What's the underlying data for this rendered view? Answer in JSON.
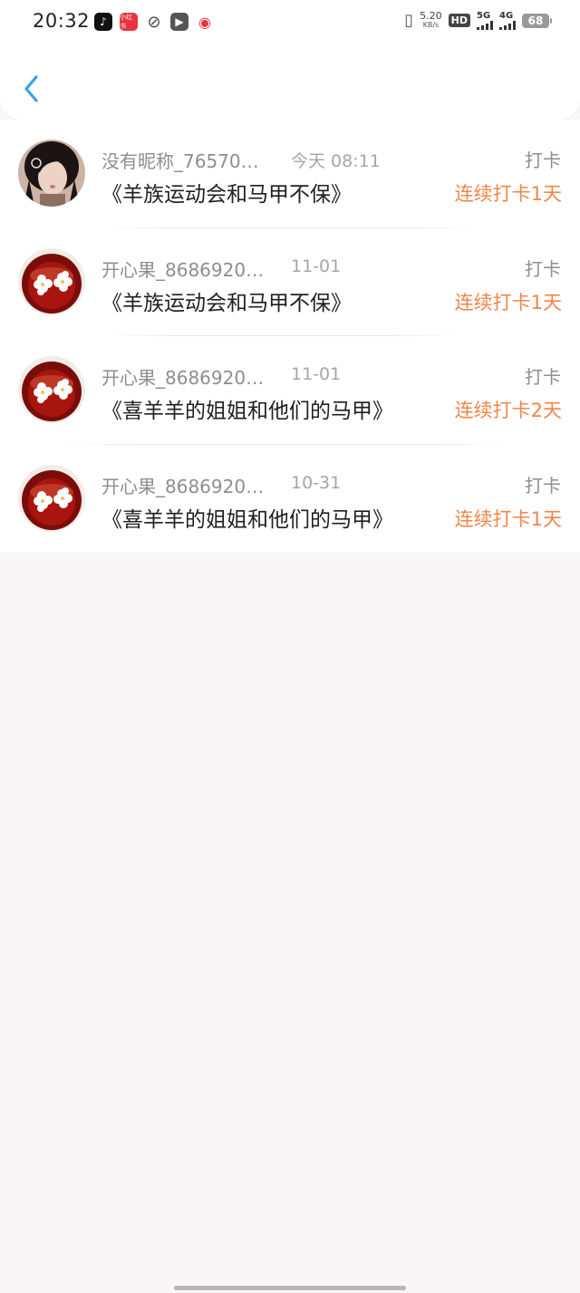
{
  "status_bar": {
    "time": "20:32",
    "app_icons": [
      "tiktok-icon",
      "xiaohongshu-icon",
      "loop-icon",
      "video-play-icon",
      "red-app-icon"
    ],
    "app_labels": {
      "xiaohongshu": "小红书"
    },
    "net_speed_value": "5.20",
    "net_speed_unit": "KB/s",
    "hd_label": "HD",
    "sim1_label": "5G",
    "sim2_label": "4G",
    "battery": "68"
  },
  "header": {
    "back_icon": "chevron-left-icon",
    "accent": "#3aa0e8"
  },
  "entries": [
    {
      "name": "没有昵称_76570…",
      "date": "今天 08:11",
      "book": "《羊族运动会和马甲不保》",
      "tag": "打卡",
      "streak": "连续打卡1天",
      "avatar": "girl-avatar"
    },
    {
      "name": "开心果_8686920…",
      "date": "11-01",
      "book": "《羊族运动会和马甲不保》",
      "tag": "打卡",
      "streak": "连续打卡1天",
      "avatar": "flower-avatar"
    },
    {
      "name": "开心果_8686920…",
      "date": "11-01",
      "book": "《喜羊羊的姐姐和他们的马甲》",
      "tag": "打卡",
      "streak": "连续打卡2天",
      "avatar": "flower-avatar"
    },
    {
      "name": "开心果_8686920…",
      "date": "10-31",
      "book": "《喜羊羊的姐姐和他们的马甲》",
      "tag": "打卡",
      "streak": "连续打卡1天",
      "avatar": "flower-avatar"
    }
  ],
  "colors": {
    "streak": "#f0864a",
    "muted": "#8e8e8e",
    "background": "#f8f6f7"
  }
}
